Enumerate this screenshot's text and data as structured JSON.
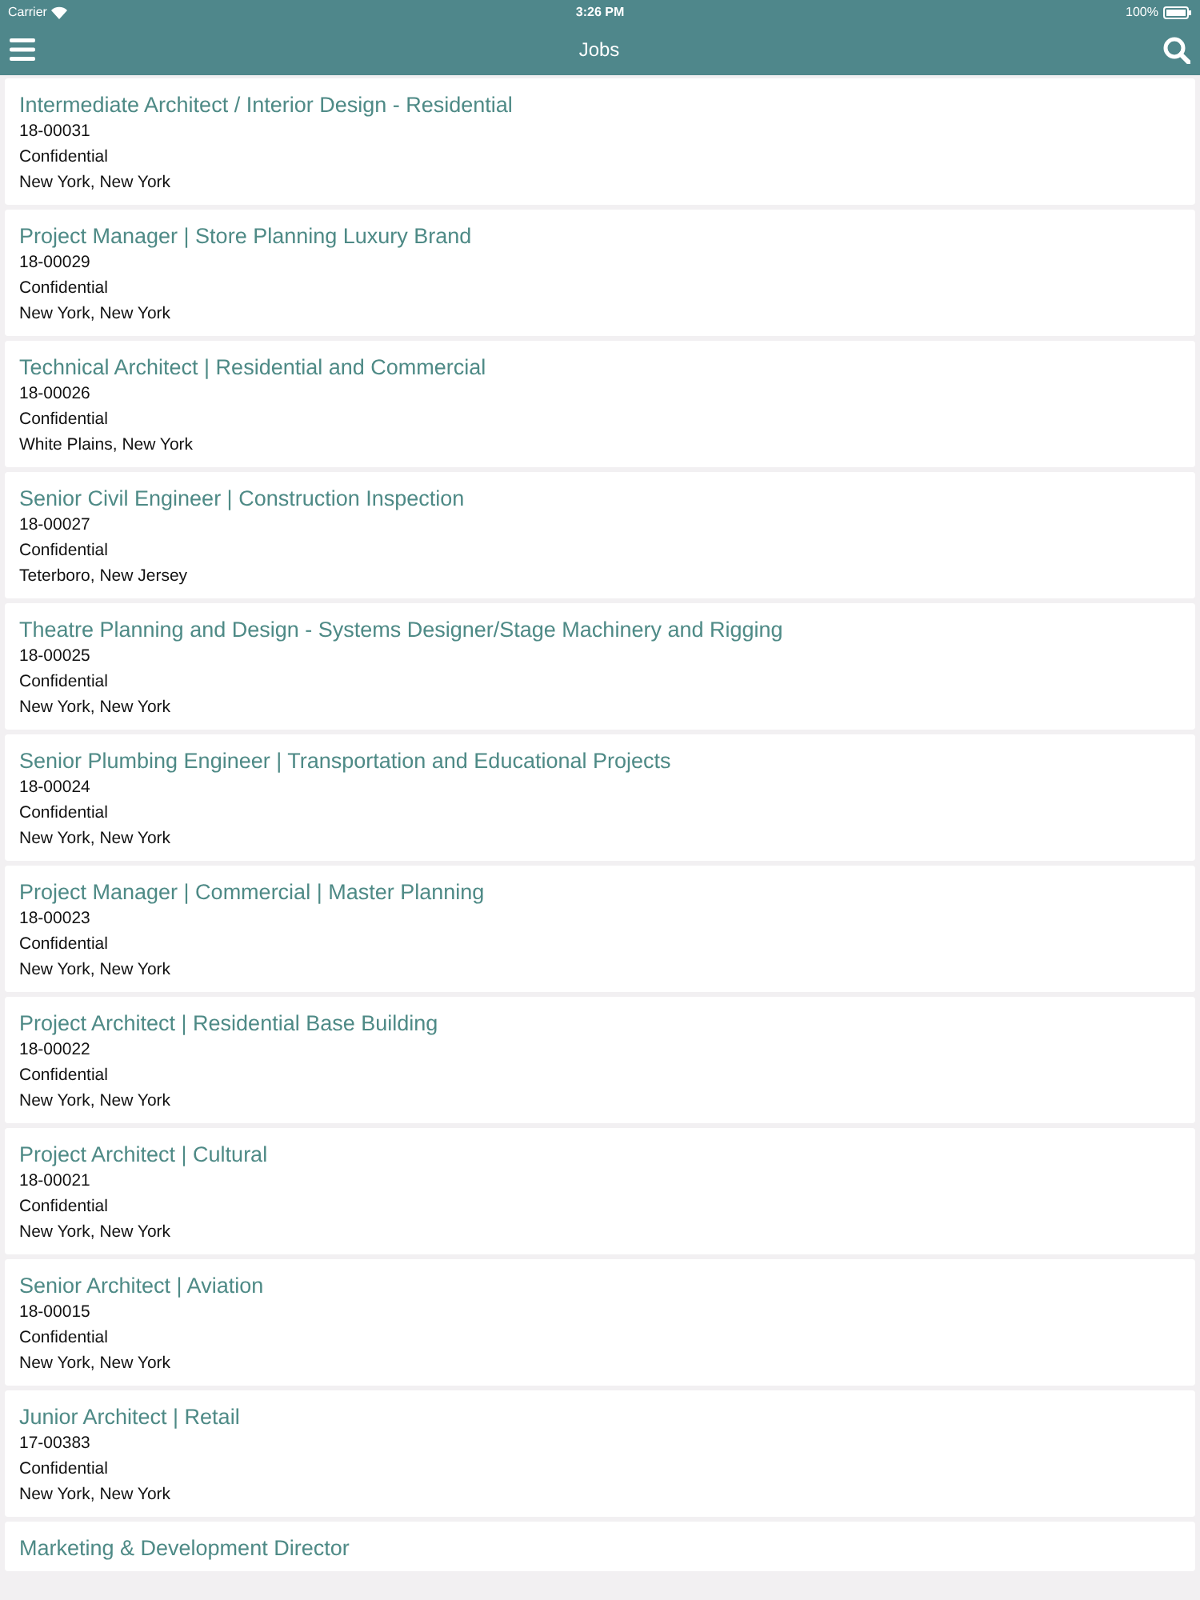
{
  "status_bar": {
    "carrier": "Carrier",
    "time": "3:26 PM",
    "battery": "100%"
  },
  "nav_bar": {
    "title": "Jobs"
  },
  "jobs": [
    {
      "title": "Intermediate Architect / Interior Design - Residential",
      "code": "18-00031",
      "salary": "Confidential",
      "location": "New York, New York"
    },
    {
      "title": "Project Manager | Store Planning Luxury Brand",
      "code": "18-00029",
      "salary": "Confidential",
      "location": "New York, New York"
    },
    {
      "title": "Technical Architect | Residential and Commercial",
      "code": "18-00026",
      "salary": "Confidential",
      "location": "White Plains, New York"
    },
    {
      "title": "Senior Civil Engineer | Construction Inspection",
      "code": "18-00027",
      "salary": "Confidential",
      "location": "Teterboro, New Jersey"
    },
    {
      "title": "Theatre Planning and Design - Systems Designer/Stage Machinery and Rigging",
      "code": "18-00025",
      "salary": "Confidential",
      "location": "New York, New York"
    },
    {
      "title": "Senior Plumbing Engineer | Transportation and Educational Projects",
      "code": "18-00024",
      "salary": "Confidential",
      "location": "New York, New York"
    },
    {
      "title": "Project Manager | Commercial | Master Planning",
      "code": "18-00023",
      "salary": "Confidential",
      "location": "New York, New York"
    },
    {
      "title": "Project Architect | Residential Base Building",
      "code": "18-00022",
      "salary": "Confidential",
      "location": "New York, New York"
    },
    {
      "title": "Project Architect | Cultural",
      "code": "18-00021",
      "salary": "Confidential",
      "location": "New York, New York"
    },
    {
      "title": "Senior Architect | Aviation",
      "code": "18-00015",
      "salary": "Confidential",
      "location": "New York, New York"
    },
    {
      "title": "Junior Architect | Retail",
      "code": "17-00383",
      "salary": "Confidential",
      "location": "New York, New York"
    },
    {
      "title": "Marketing & Development Director"
    }
  ]
}
